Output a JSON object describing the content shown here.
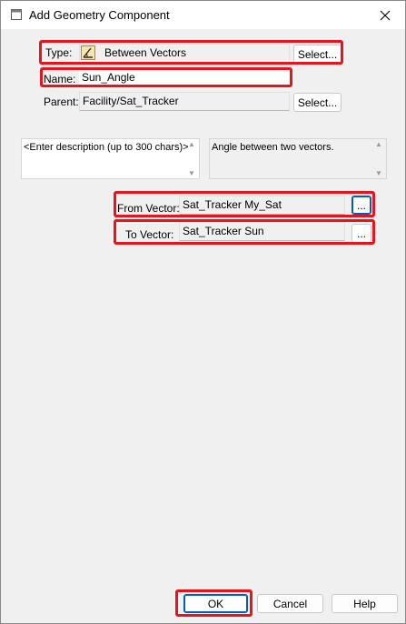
{
  "window": {
    "title": "Add Geometry Component"
  },
  "form": {
    "type_label": "Type:",
    "type_value": "Between Vectors",
    "name_label": "Name:",
    "name_value": "Sun_Angle",
    "parent_label": "Parent:",
    "parent_value": "Facility/Sat_Tracker",
    "select_label": "Select...",
    "description_placeholder": "<Enter description (up to 300 chars)>",
    "info_text": "Angle between two vectors.",
    "from_vector_label": "From Vector:",
    "from_vector_value": "Sat_Tracker My_Sat",
    "to_vector_label": "To Vector:",
    "to_vector_value": "Sat_Tracker Sun",
    "browse_label": "..."
  },
  "footer": {
    "ok_label": "OK",
    "cancel_label": "Cancel",
    "help_label": "Help"
  },
  "icons": {
    "window": "window-icon",
    "type": "angle-geometry-icon",
    "close": "close-icon"
  },
  "colors": {
    "highlight": "#e8141b",
    "focus": "#005fb8"
  }
}
